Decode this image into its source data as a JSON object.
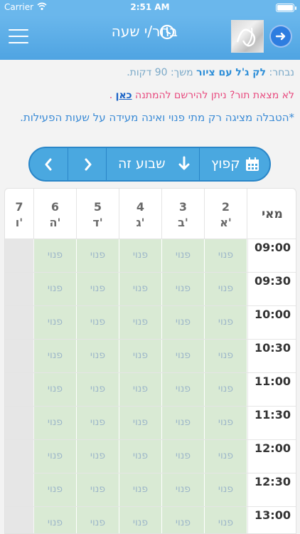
{
  "status_bar": {
    "carrier": "Carrier",
    "time": "2:51 AM"
  },
  "nav": {
    "title": "בחר/י שעה"
  },
  "info": {
    "selected_prefix": "נבחר: ",
    "service_name": "לק ג'ל עם ציור",
    "duration_text": " משך: 90 דקות.",
    "waitlist_text": "לא מצאת תור? ניתן להירשם להמתנה ",
    "waitlist_link": "כאן",
    "waitlist_end": " .",
    "note": "*הטבלה מציגה רק מתי פנוי ואינה מעידה על שעות הפעילות."
  },
  "toolbar": {
    "jump_label": "קפוץ",
    "this_week_label": "שבוע זה"
  },
  "schedule": {
    "month": "מאי",
    "days": [
      {
        "num": "2",
        "day": "א'"
      },
      {
        "num": "3",
        "day": "ב'"
      },
      {
        "num": "4",
        "day": "ג'"
      },
      {
        "num": "5",
        "day": "ד'"
      },
      {
        "num": "6",
        "day": "ה'"
      },
      {
        "num": "7",
        "day": "ו'"
      }
    ],
    "times": [
      "09:00",
      "09:30",
      "10:00",
      "10:30",
      "11:00",
      "11:30",
      "12:00",
      "12:30",
      "13:00"
    ],
    "slot_label": "פנוי"
  },
  "colors": {
    "header": "#5aaee7",
    "accent": "#2f8fd8",
    "free_slot": "#d9ead4",
    "waitlist": "#e8497e"
  }
}
